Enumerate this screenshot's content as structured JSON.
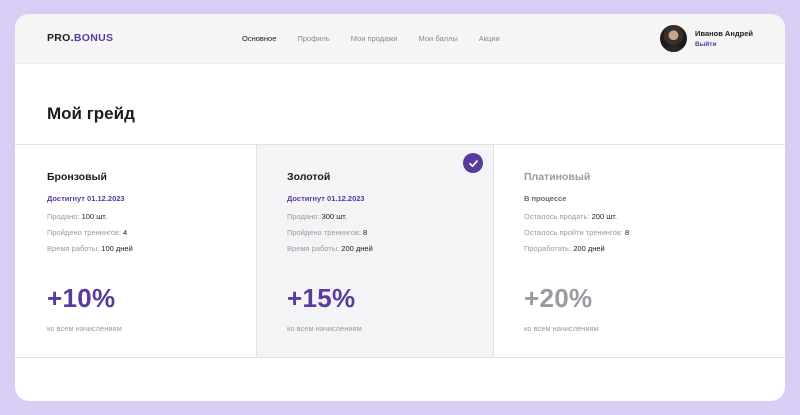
{
  "header": {
    "logo_main": "PRO.",
    "logo_accent": "BONUS",
    "nav": [
      {
        "label": "Основное",
        "active": true
      },
      {
        "label": "Профиль",
        "active": false
      },
      {
        "label": "Мои продажи",
        "active": false
      },
      {
        "label": "Мои баллы",
        "active": false
      },
      {
        "label": "Акции",
        "active": false
      }
    ],
    "user": {
      "name": "Иванов Андрей",
      "logout": "Выйти"
    }
  },
  "page": {
    "title": "Мой грейд"
  },
  "grades": [
    {
      "name": "Бронзовый",
      "status": "Достигнут 01.12.2023",
      "stats": [
        {
          "label": "Продано: ",
          "value": "100 шт."
        },
        {
          "label": "Пройдено тренингов: ",
          "value": "4"
        },
        {
          "label": "Время работы: ",
          "value": "100 дней"
        }
      ],
      "bonus": "+10%",
      "bonus_note": "ко всем начислениям",
      "current": false
    },
    {
      "name": "Золотой",
      "status": "Достигнут 01.12.2023",
      "stats": [
        {
          "label": "Продано: ",
          "value": "300 шт."
        },
        {
          "label": "Пройдено тренингов: ",
          "value": "8"
        },
        {
          "label": "Время работы: ",
          "value": "200 дней"
        }
      ],
      "bonus": "+15%",
      "bonus_note": "ко всем начислениям",
      "current": true
    },
    {
      "name": "Платиновый",
      "status": "В процессе",
      "stats": [
        {
          "label": "Осталось продать: ",
          "value": "200 шт."
        },
        {
          "label": "Осталось пройти тренингов: ",
          "value": "8"
        },
        {
          "label": "Проработать: ",
          "value": "200 дней"
        }
      ],
      "bonus": "+20%",
      "bonus_note": "ко всем начислениям",
      "current": false
    }
  ],
  "colors": {
    "accent": "#5b3a9e",
    "background": "#d9cdf6",
    "muted": "#9a9aa0"
  },
  "icons": {
    "current_grade": "check-circle-icon",
    "avatar": "user-photo"
  }
}
